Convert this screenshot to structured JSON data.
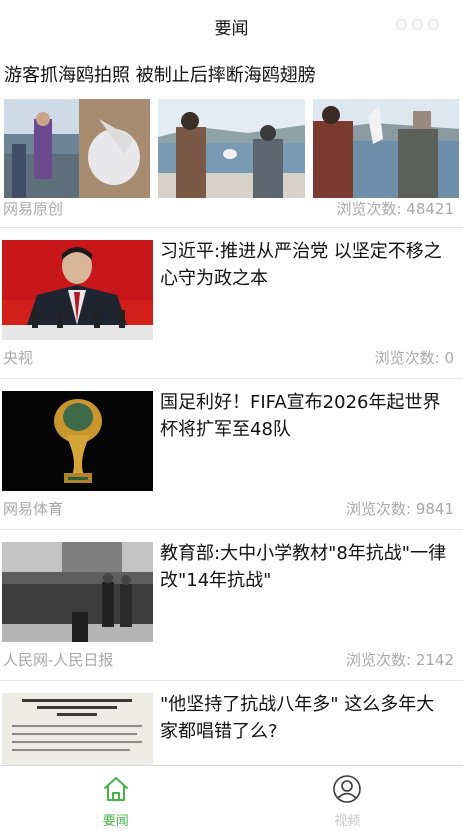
{
  "header": {
    "title": "要闻"
  },
  "articles": [
    {
      "title": "游客抓海鸥拍照 被制止后摔断海鸥翅膀",
      "source": "网易原创",
      "views": "浏览次数: 48421"
    },
    {
      "title": "习近平:推进从严治党 以坚定不移之心守为政之本",
      "source": "央视",
      "views": "浏览次数: 0"
    },
    {
      "title": "国足利好！FIFA宣布2026年起世界杯将扩军至48队",
      "source": "网易体育",
      "views": "浏览次数: 9841"
    },
    {
      "title": "教育部:大中小学教材\"8年抗战\"一律改\"14年抗战\"",
      "source": "人民网-人民日报",
      "views": "浏览次数: 2142"
    },
    {
      "title": "\"他坚持了抗战八年多\" 这么多年大家都唱错了么?",
      "source": "",
      "views": ""
    }
  ],
  "tabs": [
    {
      "label": "要闻",
      "icon": "home-icon",
      "active": true
    },
    {
      "label": "视频",
      "icon": "user-icon",
      "active": false
    }
  ],
  "colors": {
    "accent": "#45b549",
    "meta_text": "#a9a9a9",
    "divider": "#e4e4e4"
  }
}
